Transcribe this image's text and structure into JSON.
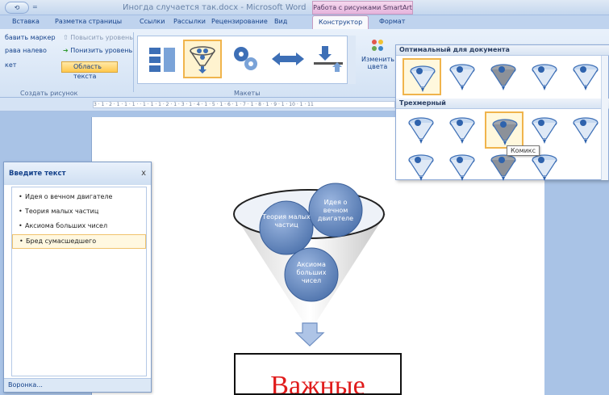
{
  "titlebar": {
    "qa_label": "⟲",
    "qa_drop": "=",
    "title": "Иногда случается так.docx - Microsoft Word",
    "context_tab_title": "Работа с рисунками SmartArt"
  },
  "tabs": [
    "Вставка",
    "Разметка страницы",
    "Ссылки",
    "Рассылки",
    "Рецензирование",
    "Вид",
    "Конструктор",
    "Формат"
  ],
  "ribbon": {
    "add_bullet": "бавить маркер",
    "rtl": "рава налево",
    "layout": "кет",
    "promote": "Повысить уровень",
    "demote": "Понизить уровень",
    "text_pane": "Область текста",
    "group_create": "Создать рисунок",
    "group_layouts": "Макеты",
    "change_colors_1": "Изменить",
    "change_colors_2": "цвета"
  },
  "styles_dropdown": {
    "section_1": "Оптимальный для документа",
    "section_2": "Трехмерный",
    "tooltip": "Комикс"
  },
  "ruler_text": "3 · 1 · 2 · 1 · 1 · 1 ·   · 1 · 1 · 1 · 2 · 1 · 3 · 1 · 4 · 1 · 5 · 1 · 6 · 1 · 7 · 1 · 8 · 1 · 9 · 1 · 10 · 1 · 11",
  "text_pane": {
    "title": "Введите текст",
    "close": "x",
    "items": [
      "Идея о вечном двигателе",
      "Теория малых частиц",
      "Аксиома больших чисел",
      "Бред сумасшедшего"
    ],
    "footer": "Воронка..."
  },
  "diagram": {
    "node1": "Теория малых частиц",
    "node2": "Идея о вечном двигателе",
    "node3": "Аксиома больших чисел",
    "result": "Важные"
  },
  "colors": {
    "accent_selected": "#f0b44c",
    "node_fill": "#6d8fc4",
    "result_text": "#e01b1b"
  }
}
